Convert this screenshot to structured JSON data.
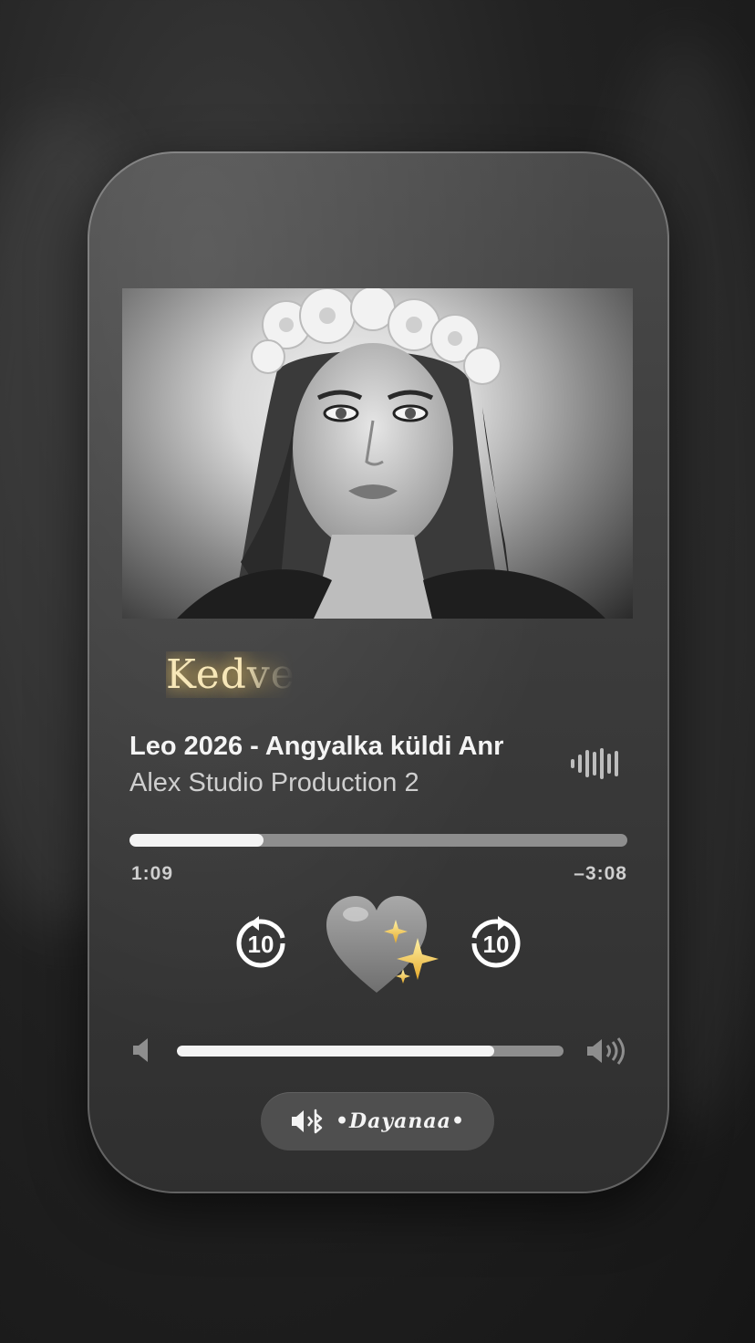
{
  "lyrics_preview": "Kedve",
  "track": {
    "title": "Leo 2026 - Angyalka küldi Anr",
    "artist": "Alex Studio Production 2"
  },
  "progress": {
    "elapsed": "1:09",
    "remaining": "–3:08",
    "fraction": 0.27
  },
  "controls": {
    "skip_back_seconds": "10",
    "skip_forward_seconds": "10",
    "center_icon": "grey-heart-sparkles-icon"
  },
  "volume": {
    "fraction": 0.82
  },
  "output": {
    "device_name": "•Dayanaa•",
    "icon": "speaker-bluetooth-icon"
  },
  "colors": {
    "accent_gold": "#f5d27a",
    "track_fill": "#f4f4f4",
    "track_bg": "#8e8e8e"
  }
}
